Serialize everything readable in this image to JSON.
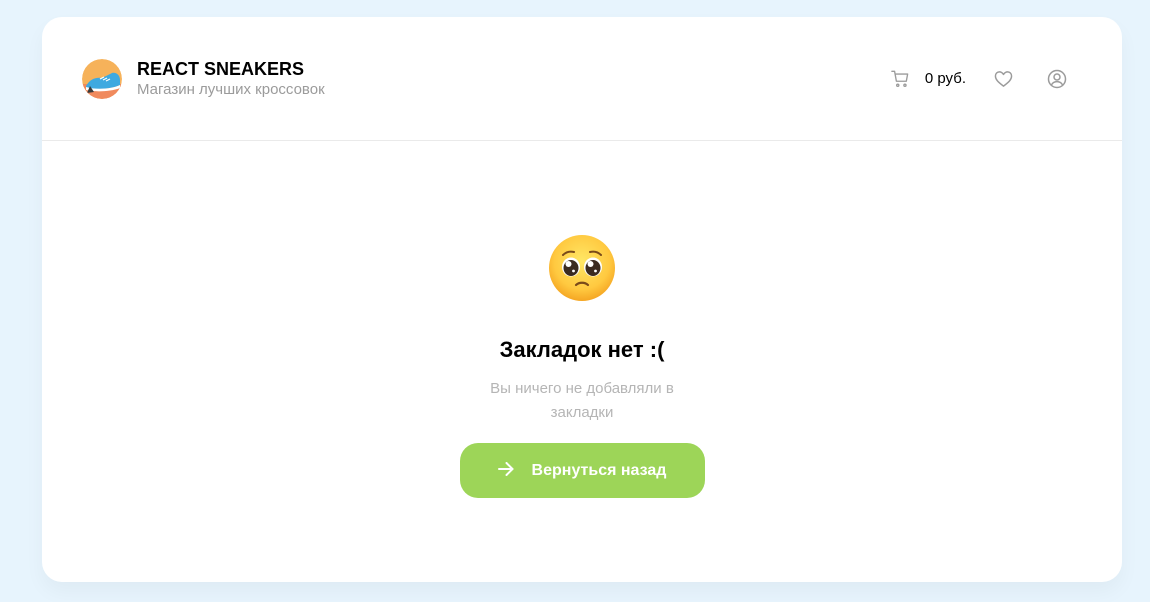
{
  "header": {
    "title": "REACT SNEAKERS",
    "subtitle": "Магазин лучших кроссовок",
    "logo_icon": "sneaker-logo-icon",
    "cart_icon": "cart-icon",
    "cart_total": "0 руб.",
    "favorites_icon": "heart-icon",
    "profile_icon": "user-icon"
  },
  "empty_state": {
    "emoji_icon": "pleading-face-emoji",
    "title": "Закладок нет :(",
    "description": "Вы ничего не добавляли в закладки",
    "button_label": "Вернуться назад",
    "button_icon": "arrow-right-icon"
  },
  "colors": {
    "page_background": "#e7f4fd",
    "card_background": "#ffffff",
    "accent_green": "#9dd558",
    "muted_text": "#9b9b9b"
  }
}
